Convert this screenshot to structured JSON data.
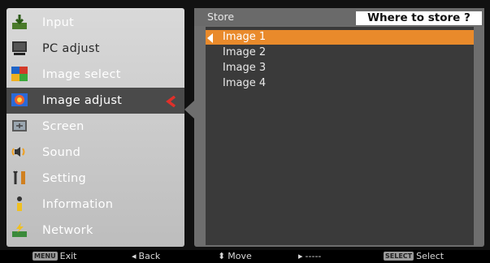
{
  "menu": {
    "items": [
      {
        "label": "Input",
        "icon": "input-icon"
      },
      {
        "label": "PC adjust",
        "icon": "pc-adjust-icon"
      },
      {
        "label": "Image select",
        "icon": "image-select-icon"
      },
      {
        "label": "Image adjust",
        "icon": "image-adjust-icon",
        "selected": true
      },
      {
        "label": "Screen",
        "icon": "screen-icon"
      },
      {
        "label": "Sound",
        "icon": "sound-icon"
      },
      {
        "label": "Setting",
        "icon": "setting-icon"
      },
      {
        "label": "Information",
        "icon": "information-icon"
      },
      {
        "label": "Network",
        "icon": "network-icon"
      }
    ]
  },
  "panel": {
    "title": "Store",
    "tag": "Where to store ?",
    "items": [
      "Image 1",
      "Image 2",
      "Image 3",
      "Image 4"
    ],
    "selected_index": 0
  },
  "bottom_bar": {
    "exit_key": "MENU",
    "exit_label": "Exit",
    "back_label": "Back",
    "move_label": "Move",
    "enter_label": "-----",
    "select_key": "SELECT",
    "select_label": "Select"
  },
  "colors": {
    "selection": "#e98a2b",
    "menu_bg": "#cfcfcf",
    "panel_bg": "#6e6e6e",
    "list_bg": "#3a3a3a"
  }
}
